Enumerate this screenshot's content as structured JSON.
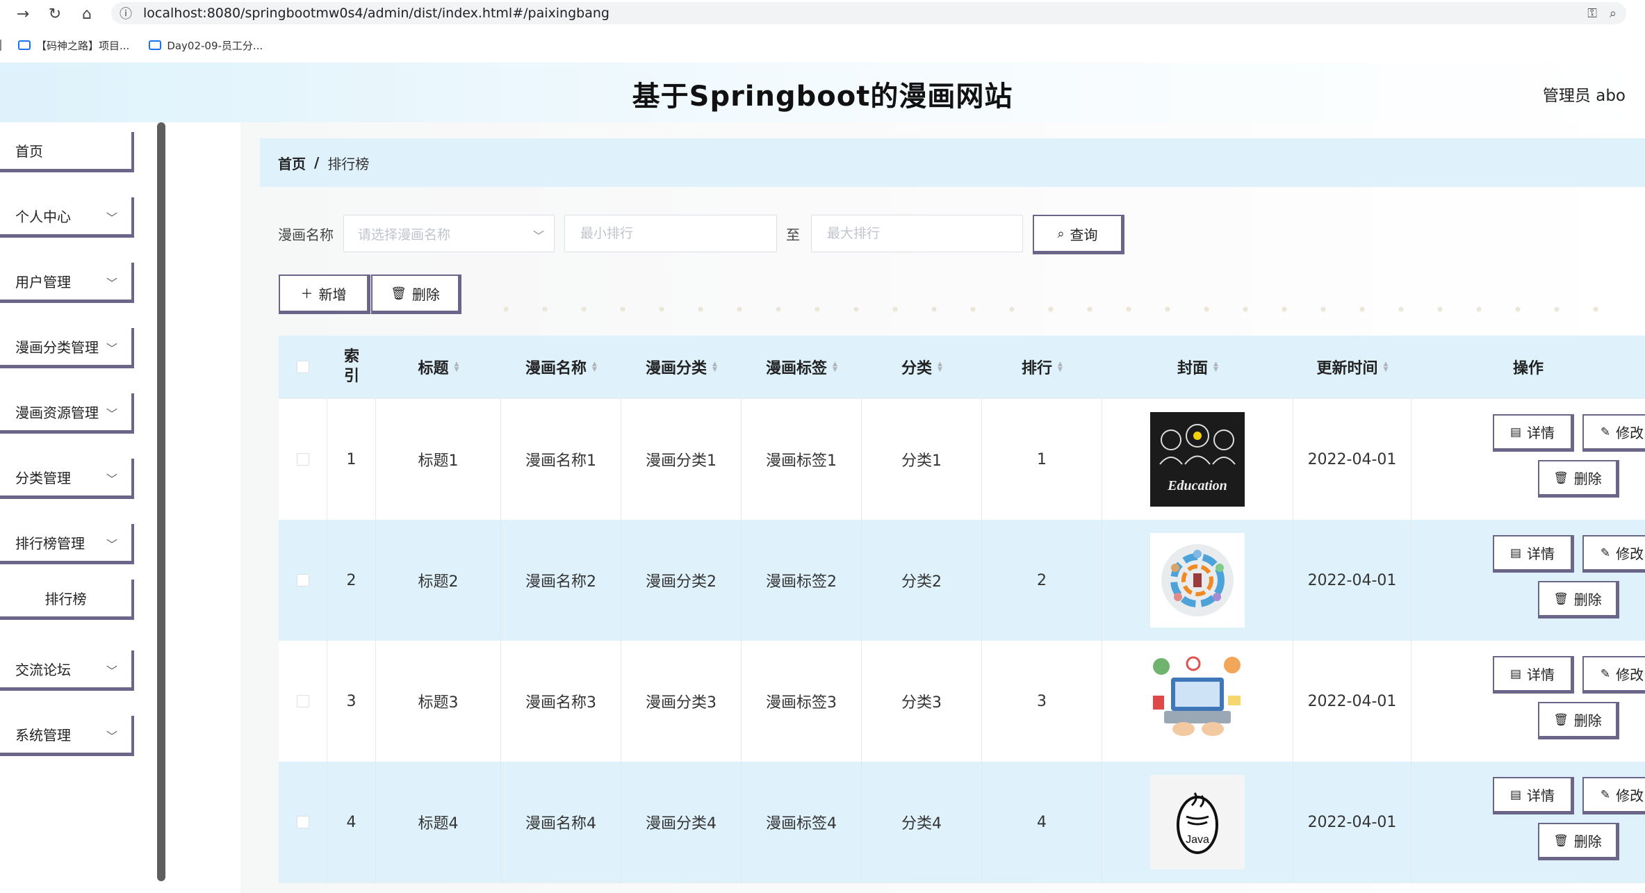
{
  "browser": {
    "url": "localhost:8080/springbootmw0s4/admin/dist/index.html#/paixingbang",
    "bookmarks": [
      "【码神之路】项目...",
      "Day02-09-员工分..."
    ]
  },
  "header": {
    "title": "基于Springboot的漫画网站",
    "user": "管理员 abo"
  },
  "sidebar": {
    "items": [
      {
        "label": "首页",
        "expandable": false
      },
      {
        "label": "个人中心",
        "expandable": true
      },
      {
        "label": "用户管理",
        "expandable": true
      },
      {
        "label": "漫画分类管理",
        "expandable": true
      },
      {
        "label": "漫画资源管理",
        "expandable": true
      },
      {
        "label": "分类管理",
        "expandable": true
      },
      {
        "label": "排行榜管理",
        "expandable": true
      },
      {
        "label": "排行榜",
        "expandable": false
      },
      {
        "label": "交流论坛",
        "expandable": true
      },
      {
        "label": "系统管理",
        "expandable": true
      }
    ]
  },
  "breadcrumb": {
    "home": "首页",
    "separator": "/",
    "current": "排行榜"
  },
  "search": {
    "name_label": "漫画名称",
    "name_placeholder": "请选择漫画名称",
    "min_placeholder": "最小排行",
    "to_label": "至",
    "max_placeholder": "最大排行",
    "query_button": "查询"
  },
  "actions": {
    "add_button": "新增",
    "delete_button": "删除"
  },
  "table": {
    "headers": {
      "index": "索引",
      "title": "标题",
      "name": "漫画名称",
      "category": "漫画分类",
      "tag": "漫画标签",
      "class": "分类",
      "rank": "排行",
      "cover": "封面",
      "updated": "更新时间",
      "ops": "操作"
    },
    "rows": [
      {
        "index": "1",
        "title": "标题1",
        "name": "漫画名称1",
        "category": "漫画分类1",
        "tag": "漫画标签1",
        "class": "分类1",
        "rank": "1",
        "updated": "2022-04-01",
        "cover_text": "Education"
      },
      {
        "index": "2",
        "title": "标题2",
        "name": "漫画名称2",
        "category": "漫画分类2",
        "tag": "漫画标签2",
        "class": "分类2",
        "rank": "2",
        "updated": "2022-04-01",
        "cover_text": ""
      },
      {
        "index": "3",
        "title": "标题3",
        "name": "漫画名称3",
        "category": "漫画分类3",
        "tag": "漫画标签3",
        "class": "分类3",
        "rank": "3",
        "updated": "2022-04-01",
        "cover_text": ""
      },
      {
        "index": "4",
        "title": "标题4",
        "name": "漫画名称4",
        "category": "漫画分类4",
        "tag": "漫画标签4",
        "class": "分类4",
        "rank": "4",
        "updated": "2022-04-01",
        "cover_text": "Java"
      }
    ],
    "row_ops": {
      "detail": "详情",
      "edit": "修改",
      "delete": "删除"
    }
  },
  "colors": {
    "accent_border": "#6b6589",
    "header_bg": "#dff2fb",
    "row_alt_bg": "#dff2fb"
  }
}
